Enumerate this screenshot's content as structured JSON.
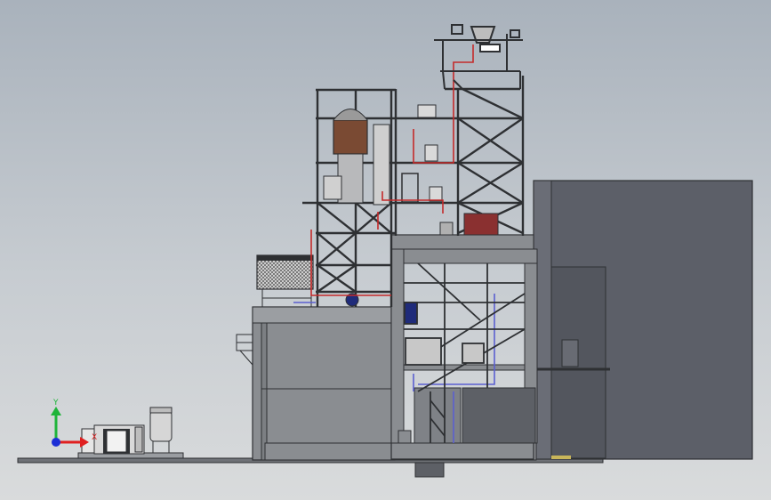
{
  "view": {
    "background_top": "#a9b2bc",
    "background_bottom": "#d9dbdc"
  },
  "triad": {
    "y_label": "Y",
    "x_label": "X",
    "y_color": "#1fb43a",
    "x_color": "#e02020",
    "z_color": "#1c2fd6"
  },
  "colors": {
    "steel": "#2e3033",
    "concrete": "#8a8d91",
    "concrete_dark": "#6e7176",
    "building": "#5c5f68",
    "pipe_red": "#c42a2a",
    "pipe_blue": "#5b5fd0",
    "equipment_brown": "#7a4a33",
    "equipment_red": "#8a3030"
  }
}
